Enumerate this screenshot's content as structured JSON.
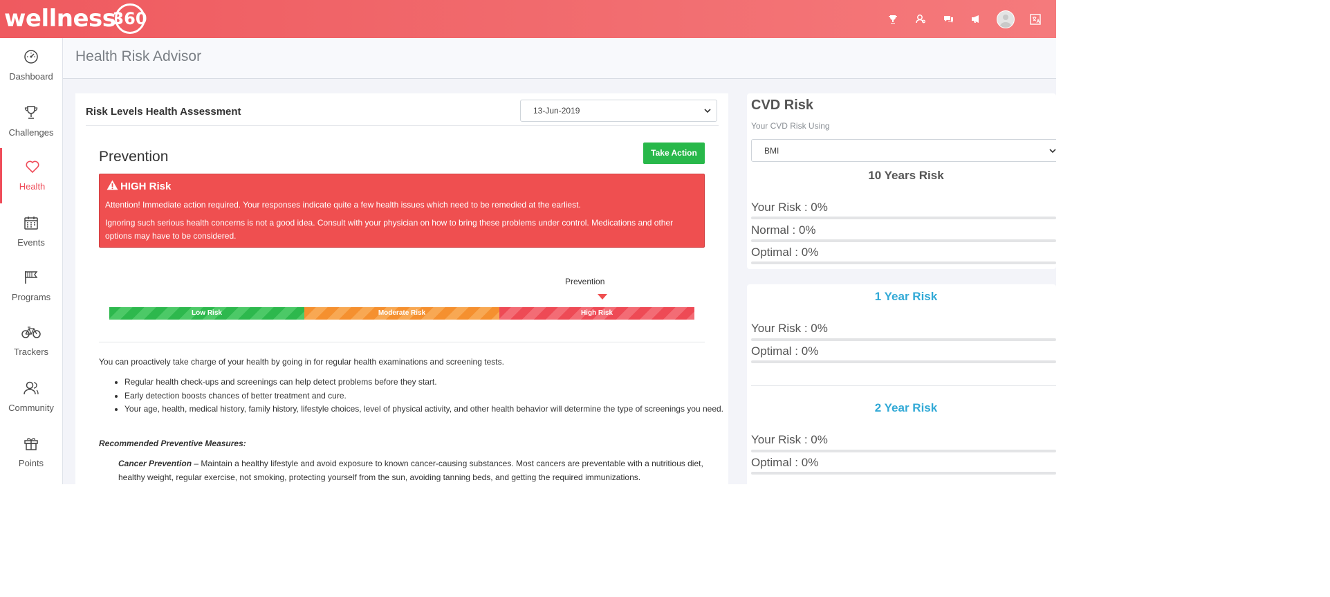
{
  "brand": {
    "word": "wellness",
    "num": "360"
  },
  "topbar_icons": [
    "trophy-icon",
    "user-search-icon",
    "chat-icon",
    "megaphone-icon",
    "avatar",
    "language-icon"
  ],
  "sidebar": {
    "items": [
      {
        "label": "Dashboard",
        "icon": "speedometer-icon"
      },
      {
        "label": "Challenges",
        "icon": "trophy-icon"
      },
      {
        "label": "Health",
        "icon": "heart-icon",
        "active": true
      },
      {
        "label": "Events",
        "icon": "calendar-icon"
      },
      {
        "label": "Programs",
        "icon": "flags-icon"
      },
      {
        "label": "Trackers",
        "icon": "bicycle-icon"
      },
      {
        "label": "Community",
        "icon": "users-icon"
      },
      {
        "label": "Points",
        "icon": "gift-icon"
      }
    ]
  },
  "page": {
    "title": "Health Risk Advisor"
  },
  "assessment": {
    "title": "Risk Levels Health Assessment",
    "date": "13-Jun-2019",
    "section_title": "Prevention",
    "take_action": "Take Action",
    "alert": {
      "heading": "HIGH Risk",
      "line1": "Attention! Immediate action required.  Your responses indicate quite a few health issues which need to be remedied at the earliest.",
      "line2": "Ignoring such serious health concerns is not a good idea. Consult with your physician on how to bring these problems under control. Medications and other options may have to be considered."
    },
    "scale": {
      "marker_label": "Prevention",
      "segments": [
        "Low Risk",
        "Moderate Risk",
        "High Risk"
      ]
    },
    "intro": "You can proactively take charge of your health by going in for regular health examinations and screening tests.",
    "bullets": [
      "Regular health check-ups and screenings can help detect problems before they start.",
      "Early detection boosts chances of better treatment and cure.",
      "Your age, health, medical history, family history, lifestyle choices, level of physical activity, and other health behavior will determine the type of screenings you need."
    ],
    "recommended_heading": "Recommended Preventive Measures:",
    "cancer": {
      "label": "Cancer Prevention",
      "text": " – Maintain a healthy lifestyle and avoid exposure to known cancer-causing substances. Most cancers are preventable with a nutritious diet, healthy weight, regular exercise, not smoking, protecting yourself from the sun, avoiding tanning beds, and getting the required immunizations."
    }
  },
  "cvd": {
    "title": "CVD Risk",
    "subtitle": "Your CVD Risk Using",
    "method": "BMI",
    "ten_year": {
      "heading": "10 Years Risk",
      "your_risk": "Your Risk : 0%",
      "normal": "Normal : 0%",
      "optimal": "Optimal : 0%"
    },
    "one_year": {
      "heading": "1 Year Risk",
      "your_risk": "Your Risk : 0%",
      "optimal": "Optimal : 0%"
    },
    "two_year": {
      "heading": "2 Year Risk",
      "your_risk": "Your Risk : 0%",
      "optimal": "Optimal : 0%"
    }
  },
  "colors": {
    "brand": "#ef5a5f",
    "alert": "#ef4f50",
    "action": "#28b84a",
    "accent_blue": "#31a9d6"
  }
}
